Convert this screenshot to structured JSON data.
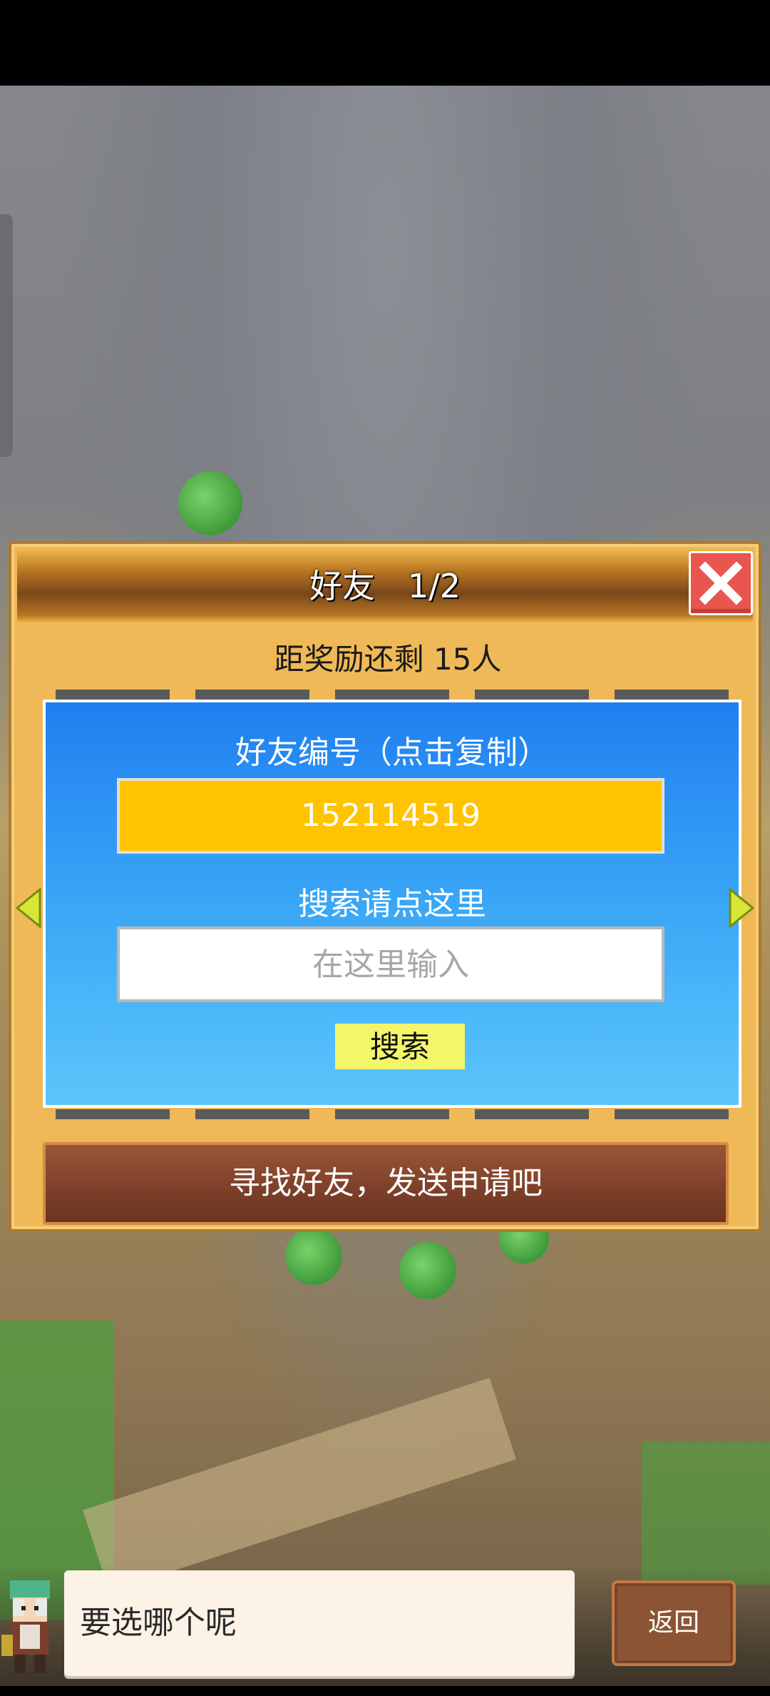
{
  "dialog": {
    "title": "好友　1/2",
    "reward_text": "距奖励还剩 15人",
    "friend_id_label": "好友编号（点击复制）",
    "friend_id_value": "152114519",
    "search_label": "搜索请点这里",
    "search_placeholder": "在这里输入",
    "search_button": "搜索",
    "banner_text": "寻找好友，发送申请吧"
  },
  "bottom": {
    "speech_text": "要选哪个呢",
    "back_button": "返回"
  },
  "icons": {
    "close": "close-icon",
    "prev": "arrow-left-icon",
    "next": "arrow-right-icon",
    "avatar": "character-avatar-icon"
  },
  "colors": {
    "panel_blue": "#1f7ff0",
    "id_box_yellow": "#ffc300",
    "close_red": "#e9554f",
    "search_button": "#f3f56a"
  }
}
